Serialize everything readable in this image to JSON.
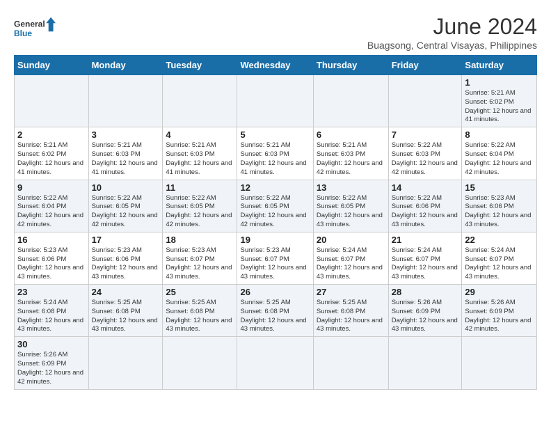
{
  "header": {
    "logo_general": "General",
    "logo_blue": "Blue",
    "title": "June 2024",
    "subtitle": "Buagsong, Central Visayas, Philippines"
  },
  "weekdays": [
    "Sunday",
    "Monday",
    "Tuesday",
    "Wednesday",
    "Thursday",
    "Friday",
    "Saturday"
  ],
  "weeks": [
    [
      {
        "day": "",
        "info": ""
      },
      {
        "day": "",
        "info": ""
      },
      {
        "day": "",
        "info": ""
      },
      {
        "day": "",
        "info": ""
      },
      {
        "day": "",
        "info": ""
      },
      {
        "day": "",
        "info": ""
      },
      {
        "day": "1",
        "info": "Sunrise: 5:21 AM\nSunset: 6:02 PM\nDaylight: 12 hours and 41 minutes."
      }
    ],
    [
      {
        "day": "2",
        "info": "Sunrise: 5:21 AM\nSunset: 6:02 PM\nDaylight: 12 hours and 41 minutes."
      },
      {
        "day": "3",
        "info": "Sunrise: 5:21 AM\nSunset: 6:03 PM\nDaylight: 12 hours and 41 minutes."
      },
      {
        "day": "4",
        "info": "Sunrise: 5:21 AM\nSunset: 6:03 PM\nDaylight: 12 hours and 41 minutes."
      },
      {
        "day": "5",
        "info": "Sunrise: 5:21 AM\nSunset: 6:03 PM\nDaylight: 12 hours and 41 minutes."
      },
      {
        "day": "6",
        "info": "Sunrise: 5:21 AM\nSunset: 6:03 PM\nDaylight: 12 hours and 42 minutes."
      },
      {
        "day": "7",
        "info": "Sunrise: 5:22 AM\nSunset: 6:03 PM\nDaylight: 12 hours and 42 minutes."
      },
      {
        "day": "8",
        "info": "Sunrise: 5:22 AM\nSunset: 6:04 PM\nDaylight: 12 hours and 42 minutes."
      }
    ],
    [
      {
        "day": "9",
        "info": "Sunrise: 5:22 AM\nSunset: 6:04 PM\nDaylight: 12 hours and 42 minutes."
      },
      {
        "day": "10",
        "info": "Sunrise: 5:22 AM\nSunset: 6:05 PM\nDaylight: 12 hours and 42 minutes."
      },
      {
        "day": "11",
        "info": "Sunrise: 5:22 AM\nSunset: 6:05 PM\nDaylight: 12 hours and 42 minutes."
      },
      {
        "day": "12",
        "info": "Sunrise: 5:22 AM\nSunset: 6:05 PM\nDaylight: 12 hours and 42 minutes."
      },
      {
        "day": "13",
        "info": "Sunrise: 5:22 AM\nSunset: 6:05 PM\nDaylight: 12 hours and 43 minutes."
      },
      {
        "day": "14",
        "info": "Sunrise: 5:22 AM\nSunset: 6:06 PM\nDaylight: 12 hours and 43 minutes."
      },
      {
        "day": "15",
        "info": "Sunrise: 5:23 AM\nSunset: 6:06 PM\nDaylight: 12 hours and 43 minutes."
      }
    ],
    [
      {
        "day": "16",
        "info": "Sunrise: 5:23 AM\nSunset: 6:06 PM\nDaylight: 12 hours and 43 minutes."
      },
      {
        "day": "17",
        "info": "Sunrise: 5:23 AM\nSunset: 6:06 PM\nDaylight: 12 hours and 43 minutes."
      },
      {
        "day": "18",
        "info": "Sunrise: 5:23 AM\nSunset: 6:07 PM\nDaylight: 12 hours and 43 minutes."
      },
      {
        "day": "19",
        "info": "Sunrise: 5:23 AM\nSunset: 6:07 PM\nDaylight: 12 hours and 43 minutes."
      },
      {
        "day": "20",
        "info": "Sunrise: 5:24 AM\nSunset: 6:07 PM\nDaylight: 12 hours and 43 minutes."
      },
      {
        "day": "21",
        "info": "Sunrise: 5:24 AM\nSunset: 6:07 PM\nDaylight: 12 hours and 43 minutes."
      },
      {
        "day": "22",
        "info": "Sunrise: 5:24 AM\nSunset: 6:07 PM\nDaylight: 12 hours and 43 minutes."
      }
    ],
    [
      {
        "day": "23",
        "info": "Sunrise: 5:24 AM\nSunset: 6:08 PM\nDaylight: 12 hours and 43 minutes."
      },
      {
        "day": "24",
        "info": "Sunrise: 5:25 AM\nSunset: 6:08 PM\nDaylight: 12 hours and 43 minutes."
      },
      {
        "day": "25",
        "info": "Sunrise: 5:25 AM\nSunset: 6:08 PM\nDaylight: 12 hours and 43 minutes."
      },
      {
        "day": "26",
        "info": "Sunrise: 5:25 AM\nSunset: 6:08 PM\nDaylight: 12 hours and 43 minutes."
      },
      {
        "day": "27",
        "info": "Sunrise: 5:25 AM\nSunset: 6:08 PM\nDaylight: 12 hours and 43 minutes."
      },
      {
        "day": "28",
        "info": "Sunrise: 5:26 AM\nSunset: 6:09 PM\nDaylight: 12 hours and 43 minutes."
      },
      {
        "day": "29",
        "info": "Sunrise: 5:26 AM\nSunset: 6:09 PM\nDaylight: 12 hours and 42 minutes."
      }
    ],
    [
      {
        "day": "30",
        "info": "Sunrise: 5:26 AM\nSunset: 6:09 PM\nDaylight: 12 hours and 42 minutes."
      },
      {
        "day": "",
        "info": ""
      },
      {
        "day": "",
        "info": ""
      },
      {
        "day": "",
        "info": ""
      },
      {
        "day": "",
        "info": ""
      },
      {
        "day": "",
        "info": ""
      },
      {
        "day": "",
        "info": ""
      }
    ]
  ]
}
